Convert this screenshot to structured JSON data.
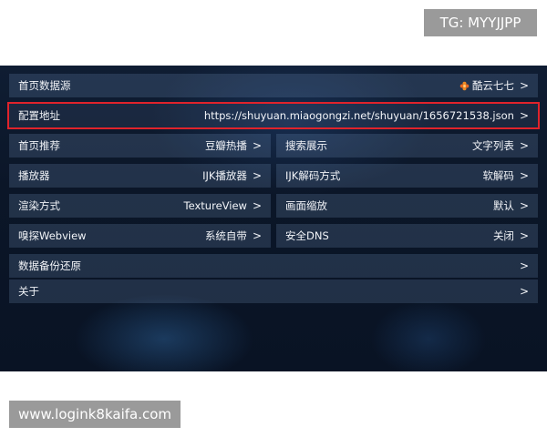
{
  "watermarks": {
    "tg": "TG: MYYJJPP",
    "site": "www.logink8kaifa.com"
  },
  "settings": {
    "home_source": {
      "label": "首页数据源",
      "value": "酷云七七",
      "icon": "orange-flower-icon"
    },
    "config_url": {
      "label": "配置地址",
      "value": "https://shuyuan.miaogongzi.net/shuyuan/1656721538.json"
    },
    "home_recommend": {
      "label": "首页推荐",
      "value": "豆瓣热播"
    },
    "search_display": {
      "label": "搜索展示",
      "value": "文字列表"
    },
    "player": {
      "label": "播放器",
      "value": "IJK播放器"
    },
    "ijk_decode": {
      "label": "IJK解码方式",
      "value": "软解码"
    },
    "render_mode": {
      "label": "渲染方式",
      "value": "TextureView"
    },
    "screen_scale": {
      "label": "画面缩放",
      "value": "默认"
    },
    "sniff_webview": {
      "label": "嗅探Webview",
      "value": "系统自带"
    },
    "safe_dns": {
      "label": "安全DNS",
      "value": "关闭"
    },
    "backup_restore": {
      "label": "数据备份还原"
    },
    "about": {
      "label": "关于"
    },
    "chevron": ">"
  },
  "colors": {
    "selection_border": "#e0232b",
    "row_background": "#3a4d66",
    "screen_background": "#0b1628",
    "badge_background": "#9a9a9a"
  }
}
